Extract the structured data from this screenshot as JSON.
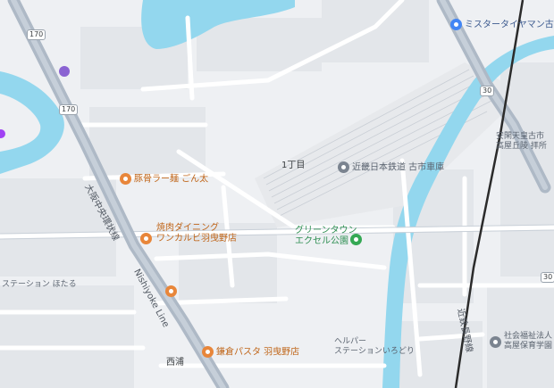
{
  "map": {
    "colors": {
      "background": "#eef0f3",
      "water": "#93d7ee",
      "road_major": "#aeb9c6",
      "road_minor": "#ffffff",
      "block": "#dfe3e8",
      "rail": "#2b2b2b",
      "poi_food": "#c0661a",
      "poi_park": "#2f8f53",
      "poi_general": "#5b6470"
    },
    "route_shields": [
      "170",
      "170",
      "30",
      "30"
    ],
    "district_label": "1丁目",
    "road_label_left": "大阪中央環状線",
    "road_label_main": "Nishiyoke Line",
    "road_label_right": "近鉄長野線",
    "pois": [
      {
        "label": "ミスタータイヤマン古市店",
        "kind": "shop",
        "icon": "shopping-pin-icon"
      },
      {
        "label": "近畿日本鉄道 古市車庫",
        "kind": "general",
        "icon": "train-depot-icon"
      },
      {
        "label": "豚骨ラー麺 ごん太",
        "kind": "food",
        "icon": "restaurant-icon"
      },
      {
        "label": "焼肉ダイニング\nワンカルビ羽曳野店",
        "kind": "food",
        "icon": "restaurant-icon"
      },
      {
        "label": "グリーンタウン\nエクセル公園",
        "kind": "park",
        "icon": "park-tree-icon"
      },
      {
        "label": "鎌倉パスタ 羽曳野店",
        "kind": "food",
        "icon": "restaurant-icon"
      },
      {
        "label": "安閑天皇古市\n高屋丘陵 拝所",
        "kind": "general",
        "icon": "landmark-icon"
      },
      {
        "label": "ヘルパー\nステーションいろどり",
        "kind": "general",
        "icon": "care-facility-icon"
      },
      {
        "label": "社会福祉法人\n高屋保育学園",
        "kind": "general",
        "icon": "school-icon"
      },
      {
        "label": "ステーション ほたる",
        "kind": "general",
        "icon": "facility-icon"
      },
      {
        "label": "西浦",
        "kind": "place",
        "icon": ""
      }
    ]
  }
}
